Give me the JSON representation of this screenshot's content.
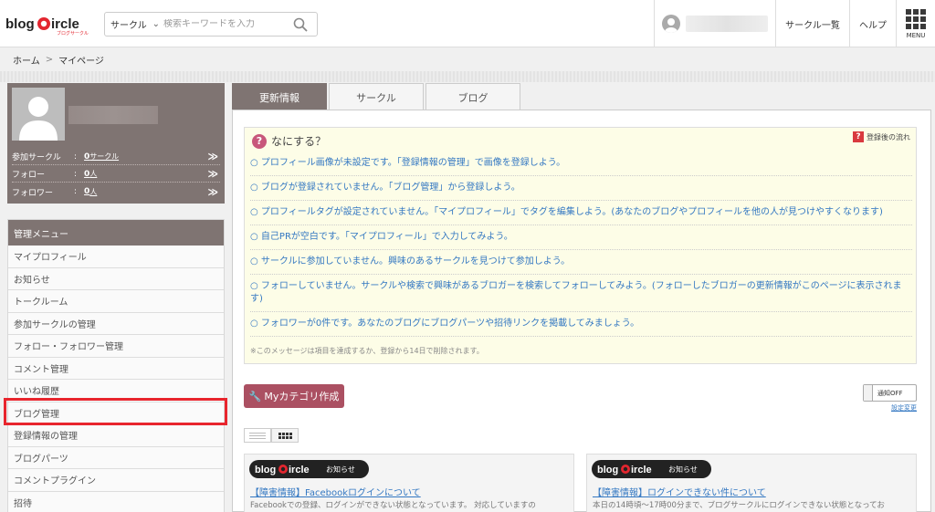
{
  "header": {
    "logo_text": "blogCircle",
    "logo_sub": "ブログサークル",
    "search": {
      "select_label": "サークル",
      "placeholder": "検索キーワードを入力"
    },
    "links": {
      "circles": "サークル一覧",
      "help": "ヘルプ",
      "menu": "MENU"
    }
  },
  "breadcrumb": {
    "home": "ホーム",
    "separator": ">",
    "current": "マイページ"
  },
  "profile": {
    "rows": [
      {
        "label": "参加サークル",
        "colon": ":",
        "value": "0",
        "unit": "サークル",
        "arrow": "≫"
      },
      {
        "label": "フォロー",
        "colon": ":",
        "value": "0",
        "unit": "人",
        "arrow": "≫"
      },
      {
        "label": "フォロワー",
        "colon": ":",
        "value": "0",
        "unit": "人",
        "arrow": "≫"
      }
    ]
  },
  "menu": {
    "title": "管理メニュー",
    "items": [
      "マイプロフィール",
      "お知らせ",
      "トークルーム",
      "参加サークルの管理",
      "フォロー・フォロワー管理",
      "コメント管理",
      "いいね履歴",
      "ブログ管理",
      "登録情報の管理",
      "ブログパーツ",
      "コメントプラグイン",
      "招待"
    ]
  },
  "tabs": [
    "更新情報",
    "サークル",
    "ブログ"
  ],
  "whatdo": {
    "qmark": "?",
    "title": "なにする？",
    "flow_label": "登録後の流れ",
    "bullet": "○",
    "items": [
      "プロフィール画像が未設定です。「登録情報の管理」で画像を登録しよう。",
      "ブログが登録されていません。「ブログ管理」から登録しよう。",
      "プロフィールタグが設定されていません。「マイプロフィール」でタグを編集しよう。(あなたのブログやプロフィールを他の人が見つけやすくなります)",
      "自己PRが空白です。「マイプロフィール」で入力してみよう。",
      "サークルに参加していません。興味のあるサークルを見つけて参加しよう。",
      "フォローしていません。サークルや検索で興味があるブロガーを検索してフォローしてみよう。(フォローしたブロガーの更新情報がこのページに表示されます)",
      "フォロワーが0件です。あなたのブログにブログパーツや招待リンクを掲載してみましょう。"
    ],
    "note": "※このメッセージは項目を達成するか、登録から14日で削除されます。"
  },
  "category_button": "Myカテゴリ作成",
  "notify": {
    "label": "通知OFF",
    "settings": "設定変更"
  },
  "news": [
    {
      "badge_logo": "blogCircle",
      "badge_tag": "お知らせ",
      "title": "【障害情報】Facebookログインについて",
      "body": "Facebookでの登録、ログインができない状態となっています。 対応していますの"
    },
    {
      "badge_logo": "blogCircle",
      "badge_tag": "お知らせ",
      "title": "【障害情報】ログインできない件について",
      "body": "本日の14時頃～17時00分まで、ブログサークルにログインできない状態となってお"
    }
  ]
}
